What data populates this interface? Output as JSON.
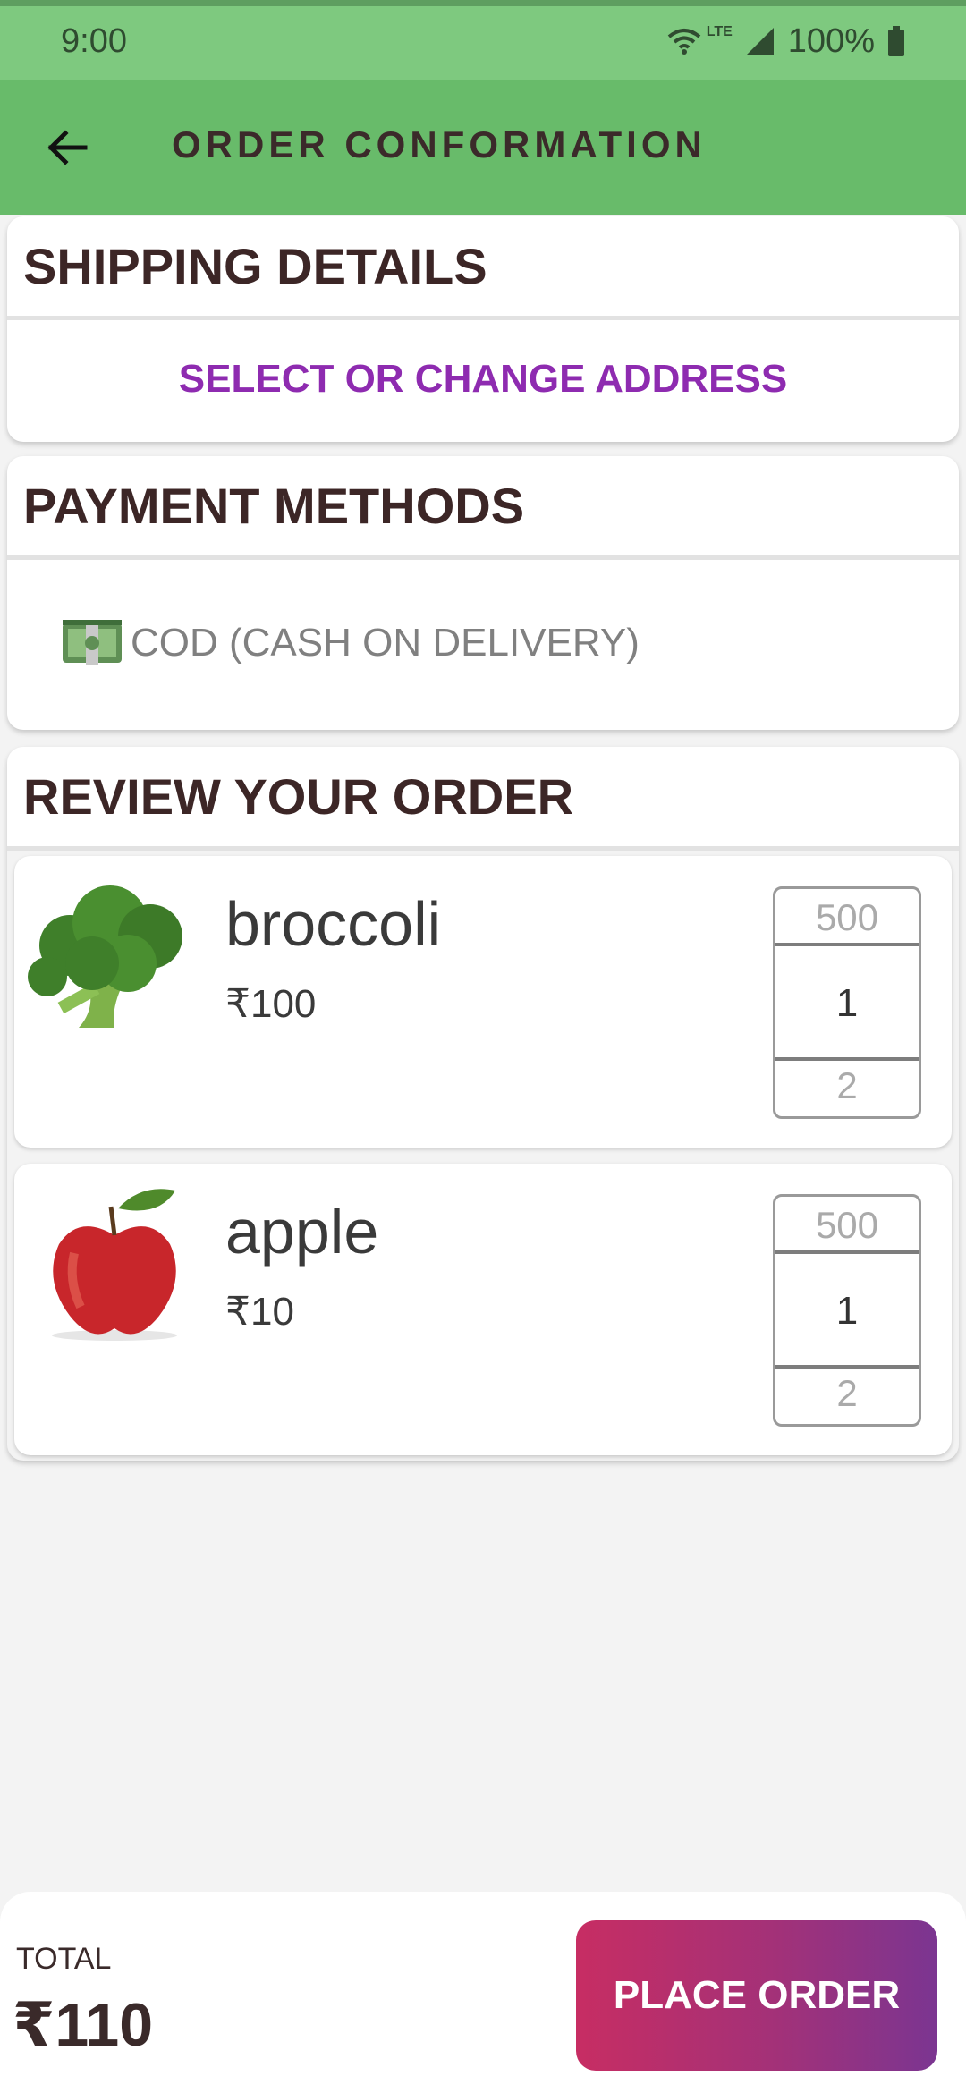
{
  "status_bar": {
    "time": "9:00",
    "network": "LTE",
    "battery": "100%"
  },
  "app_bar": {
    "back_icon": "arrow-left-icon",
    "title": "ORDER CONFORMATION"
  },
  "shipping": {
    "title": "SHIPPING DETAILS",
    "address_button": "SELECT OR CHANGE ADDRESS"
  },
  "payment": {
    "title": "PAYMENT METHODS",
    "method_icon": "cash-icon",
    "method_label": "COD (CASH ON DELIVERY)"
  },
  "review": {
    "title": "REVIEW YOUR ORDER",
    "items": [
      {
        "name": "broccoli",
        "price": "₹100",
        "picker_prev": "500",
        "quantity": "1",
        "picker_next": "2",
        "image": "broccoli-image"
      },
      {
        "name": "apple",
        "price": "₹10",
        "picker_prev": "500",
        "quantity": "1",
        "picker_next": "2",
        "image": "apple-image"
      }
    ]
  },
  "footer": {
    "total_label": "TOTAL",
    "total_value": "₹110",
    "place_order": "PLACE ORDER"
  },
  "colors": {
    "status_bar": "#7ec97f",
    "app_bar": "#68bb6a",
    "accent_link": "#8e2bb0",
    "button_gradient_start": "#c72d63",
    "button_gradient_end": "#7b3591"
  }
}
